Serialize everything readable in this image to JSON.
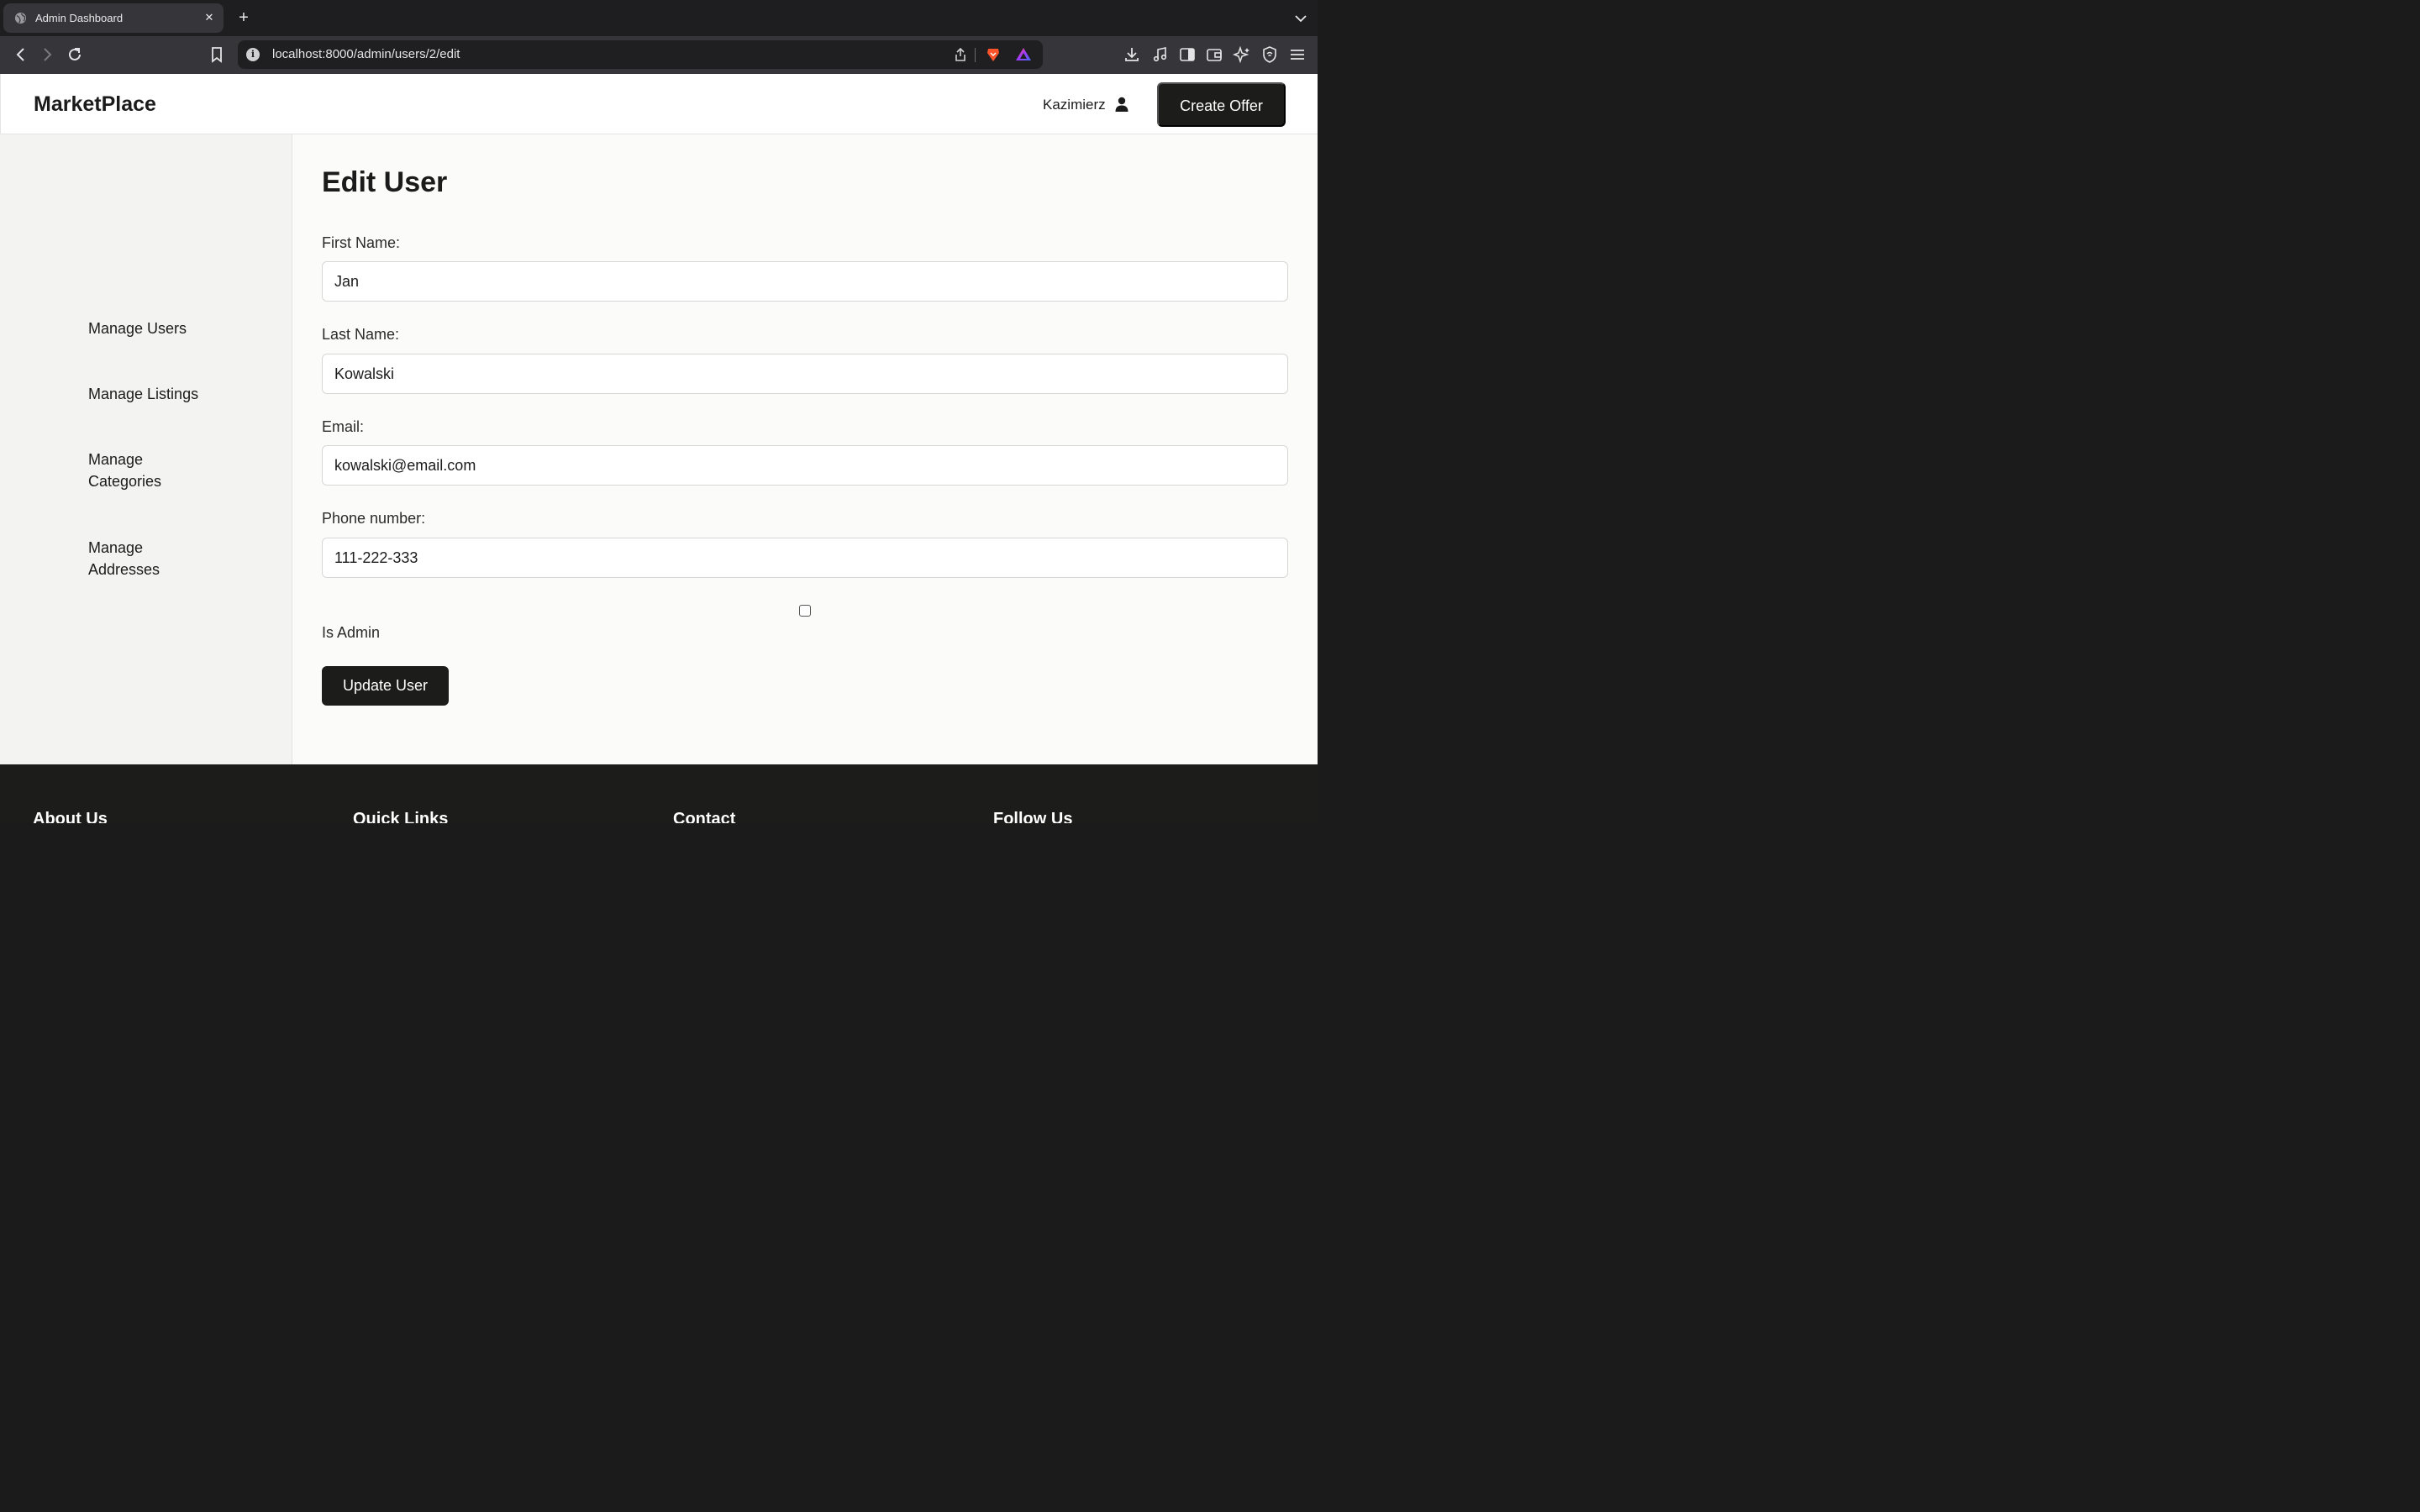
{
  "browser": {
    "tab_title": "Admin Dashboard",
    "tab_close": "✕",
    "new_tab": "+",
    "url": "localhost:8000/admin/users/2/edit",
    "url_info": "i"
  },
  "header": {
    "logo": "MarketPlace",
    "user_name": "Kazimierz",
    "create_offer_label": "Create Offer"
  },
  "sidebar": {
    "items": [
      {
        "label": "Manage Users"
      },
      {
        "label": "Manage Listings"
      },
      {
        "label": "Manage Categories"
      },
      {
        "label": "Manage Addresses"
      }
    ]
  },
  "form": {
    "title": "Edit User",
    "first_name_label": "First Name:",
    "first_name_value": "Jan",
    "last_name_label": "Last Name:",
    "last_name_value": "Kowalski",
    "email_label": "Email:",
    "email_value": "kowalski@email.com",
    "phone_label": "Phone number:",
    "phone_value": "111-222-333",
    "is_admin_label": "Is Admin",
    "is_admin_checked": false,
    "submit_label": "Update User"
  },
  "footer": {
    "headings": [
      "About Us",
      "Quick Links",
      "Contact",
      "Follow Us"
    ]
  },
  "colors": {
    "brand_dark": "#1c1c1a",
    "page_bg": "#fbfbfa",
    "sidebar_bg": "#f3f3f2",
    "chrome_bg": "#36363a"
  }
}
